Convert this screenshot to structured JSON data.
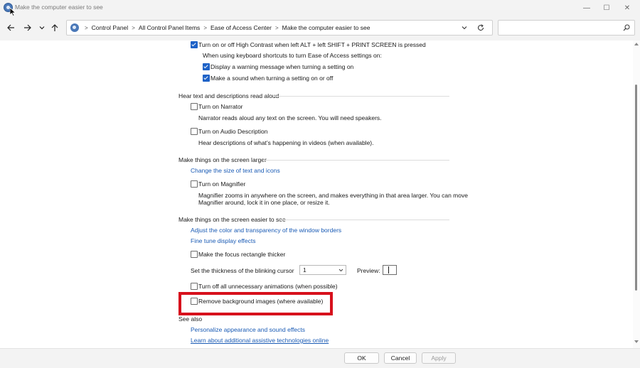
{
  "window": {
    "title": "Make the computer easier to see",
    "minimize": "—",
    "maximize": "☐",
    "close": "✕"
  },
  "address_bar": {
    "breadcrumbs": [
      "Control Panel",
      "All Control Panel Items",
      "Ease of Access Center",
      "Make the computer easier to see"
    ],
    "separator": ">"
  },
  "search": {
    "placeholder": ""
  },
  "content": {
    "high_contrast_toggle": "Turn on or off High Contrast when left ALT + left SHIFT + PRINT SCREEN is pressed",
    "shortcut_intro": "When using keyboard shortcuts to turn Ease of Access settings on:",
    "warning_message": "Display a warning message when turning a setting on",
    "make_sound": "Make a sound when turning a setting on or off",
    "hear_text_header": "Hear text and descriptions read aloud",
    "narrator": "Turn on Narrator",
    "narrator_desc": "Narrator reads aloud any text on the screen. You will need speakers.",
    "audio_description": "Turn on Audio Description",
    "audio_description_desc": "Hear descriptions of what’s happening in videos (when available).",
    "larger_header": "Make things on the screen larger",
    "change_text_size": "Change the size of text and icons",
    "magnifier": "Turn on Magnifier",
    "magnifier_desc_1": "Magnifier zooms in anywhere on the screen, and makes everything in that area larger. You can move",
    "magnifier_desc_2": "Magnifier around, lock it in one place, or resize it.",
    "easier_header": "Make things on the screen easier to see",
    "adjust_color": "Adjust the color and transparency of the window borders",
    "fine_tune": "Fine tune display effects",
    "focus_rectangle": "Make the focus rectangle thicker",
    "cursor_thickness_label": "Set the thickness of the blinking cursor",
    "cursor_thickness_value": "1",
    "preview_label": "Preview:",
    "animations": "Turn off all unnecessary animations (when possible)",
    "background_images": "Remove background images (where available)",
    "see_also_header": "See also",
    "personalize": "Personalize appearance and sound effects",
    "learn_more": "Learn about additional assistive technologies online"
  },
  "checkboxes": {
    "high_contrast": true,
    "warning_message": true,
    "make_sound": true,
    "narrator": false,
    "audio_description": false,
    "magnifier": false,
    "focus_rectangle": false,
    "animations": false,
    "background_images": false
  },
  "buttons": {
    "ok": "OK",
    "cancel": "Cancel",
    "apply": "Apply"
  },
  "colors": {
    "accent": "#1e62c7",
    "link": "#1a5bb5",
    "highlight": "#d7101c"
  }
}
